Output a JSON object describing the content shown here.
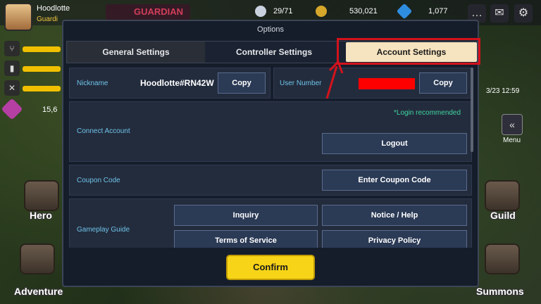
{
  "hud": {
    "player_name": "Hoodlotte",
    "player_title": "Guardi",
    "guardian_banner": "GUARDIAN",
    "stamina": "29/71",
    "gold": "530,021",
    "gems": "1,077",
    "side_count": "15,6",
    "event_timer": "3/23 12:59",
    "menu_label": "Menu",
    "hero_label": "Hero",
    "adventure_label": "Adventure",
    "guild_label": "Guild",
    "summons_label": "Summons"
  },
  "dialog": {
    "title": "Options",
    "tabs": {
      "general": "General Settings",
      "controller": "Controller Settings",
      "account": "Account Settings"
    },
    "nickname": {
      "label": "Nickname",
      "value": "Hoodlotte#RN42W",
      "copy": "Copy"
    },
    "user_number": {
      "label": "User Number",
      "copy": "Copy"
    },
    "connect_account": {
      "label": "Connect Account",
      "note": "*Login recommended",
      "logout": "Logout"
    },
    "coupon": {
      "label": "Coupon Code",
      "button": "Enter Coupon Code"
    },
    "guide": {
      "label": "Gameplay Guide",
      "inquiry": "Inquiry",
      "notice": "Notice / Help",
      "terms": "Terms of Service",
      "privacy": "Privacy Policy"
    },
    "confirm": "Confirm"
  },
  "colors": {
    "accent_tab": "#f6e3bf",
    "confirm": "#f7d417",
    "highlight": "#d4121c",
    "label": "#6fc3e8",
    "note": "#3fd5a0"
  },
  "icons": [
    "mail-icon",
    "gear-icon",
    "chat-icon",
    "diamond-icon",
    "gold-coin-icon",
    "stamina-icon",
    "chevron-left-icon"
  ]
}
